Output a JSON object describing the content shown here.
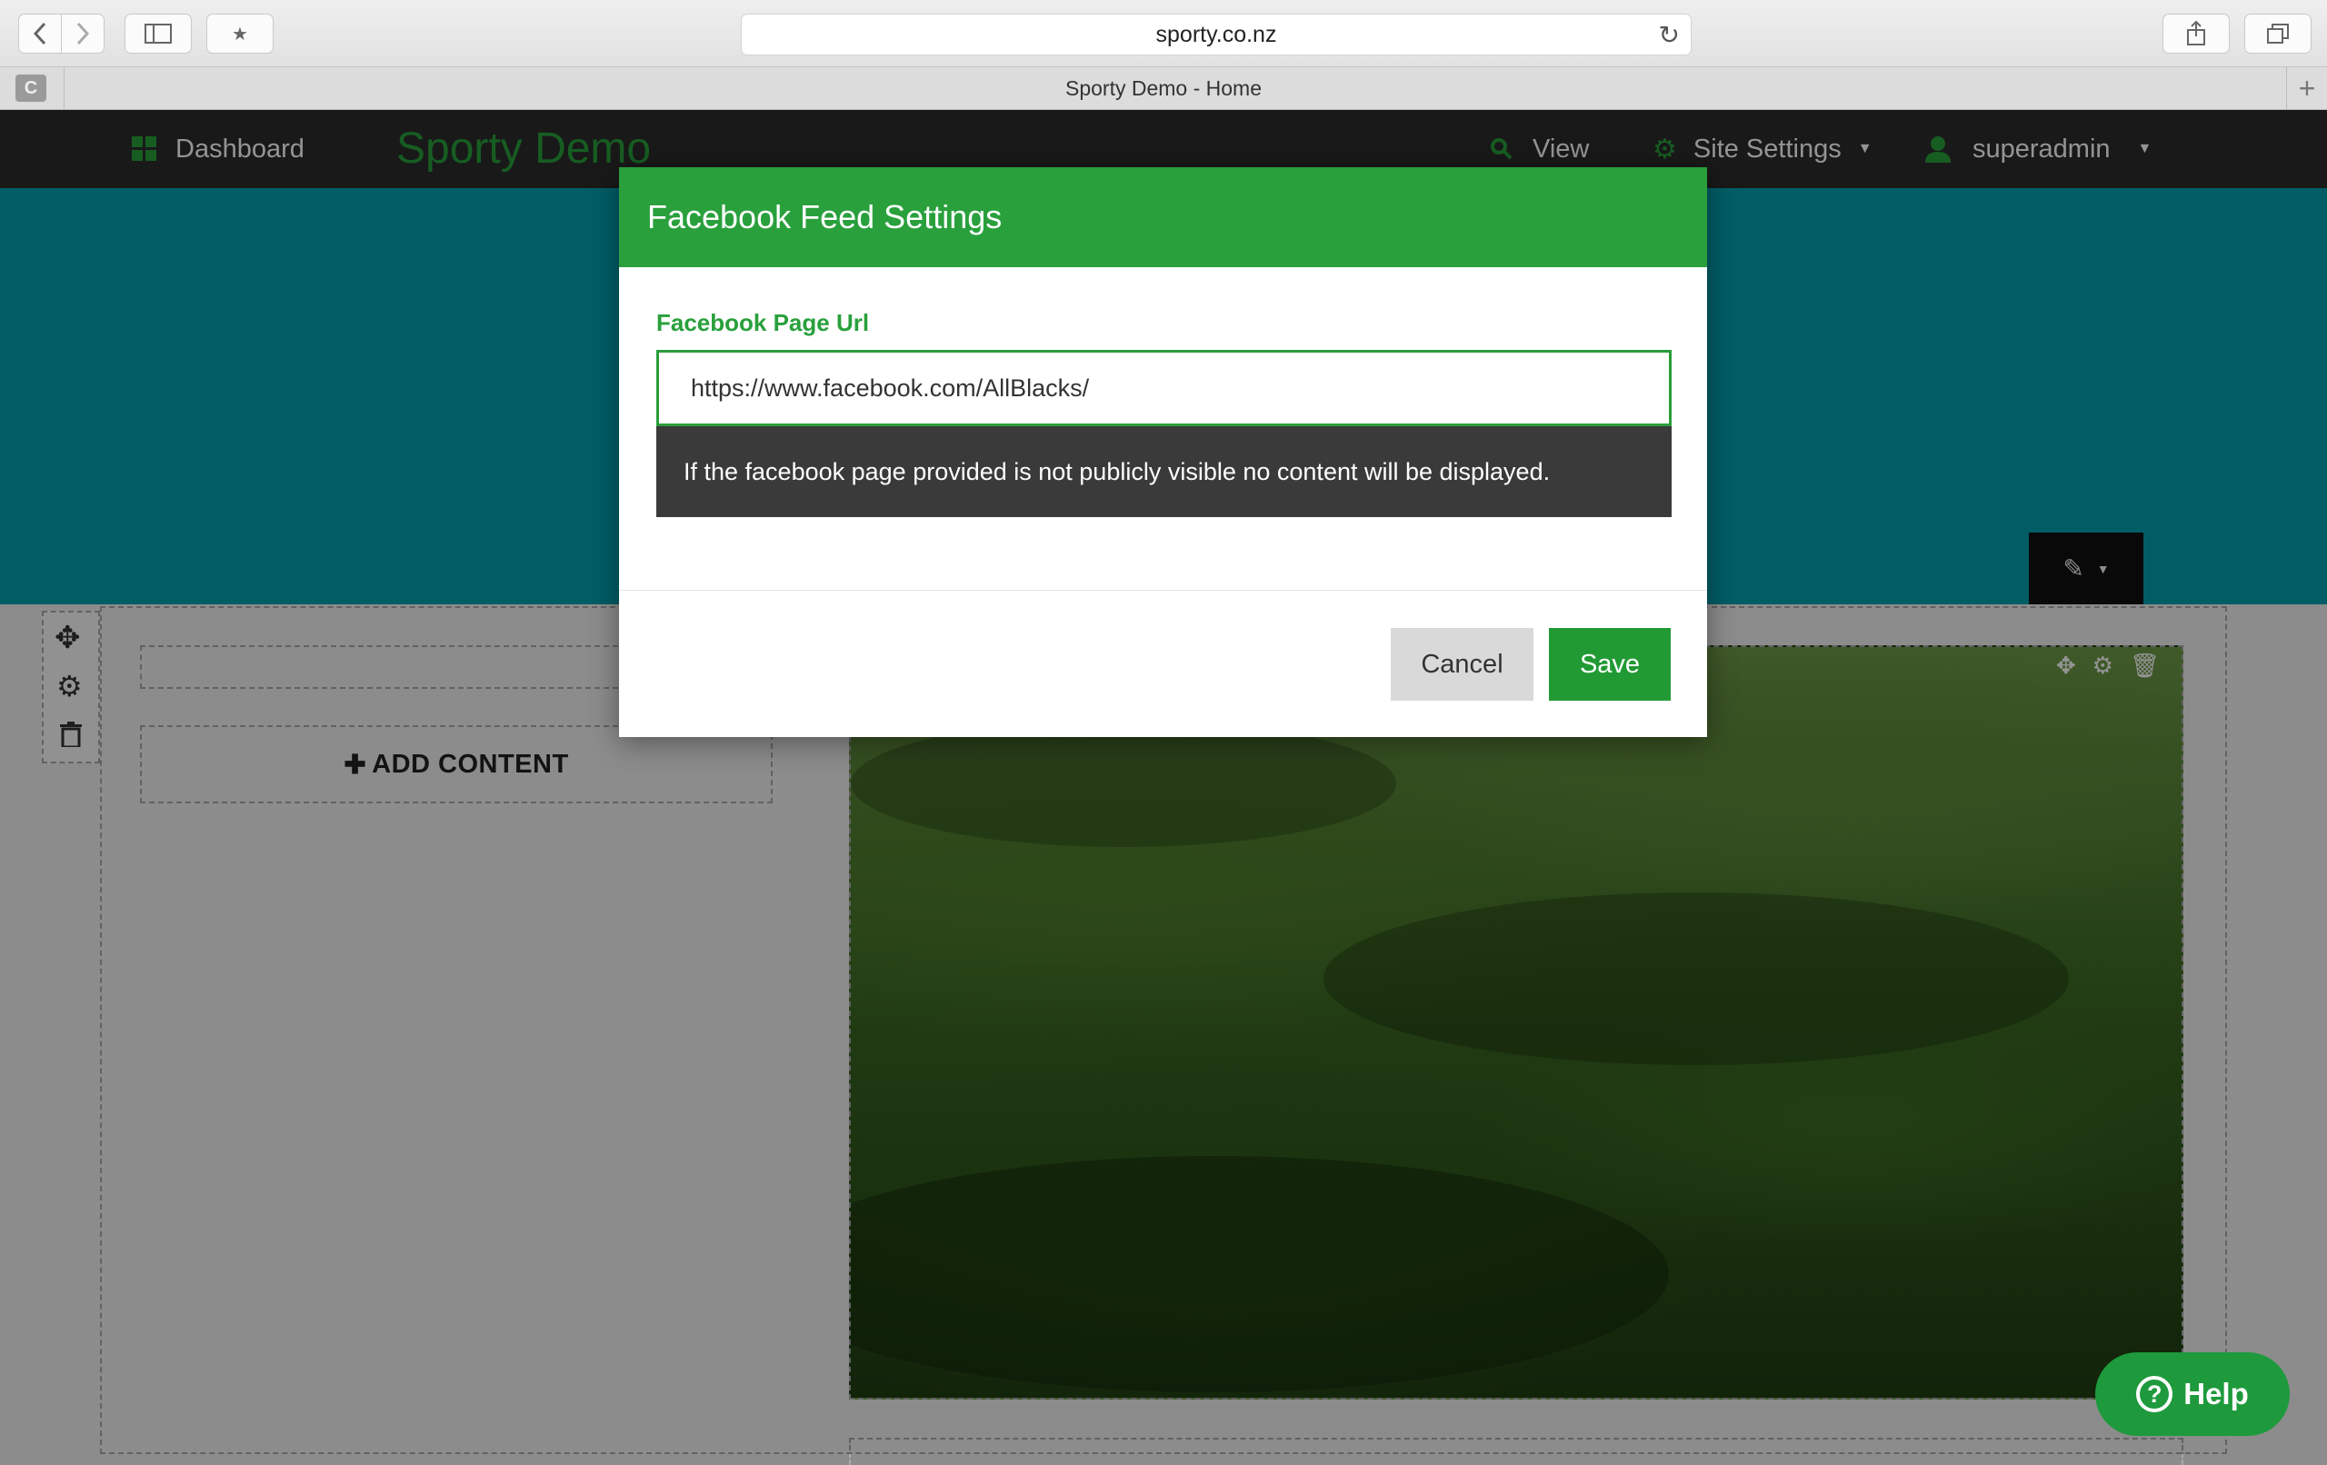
{
  "browser": {
    "url": "sporty.co.nz",
    "tab_title": "Sporty Demo - Home",
    "tab_favicon_letter": "C"
  },
  "topnav": {
    "dashboard_label": "Dashboard",
    "brand": "Sporty Demo",
    "view_label": "View",
    "site_settings_label": "Site Settings",
    "user_label": "superadmin"
  },
  "page": {
    "add_content_label": "ADD CONTENT"
  },
  "modal": {
    "title": "Facebook Feed Settings",
    "field_label": "Facebook Page Url",
    "field_value": "https://www.facebook.com/AllBlacks/",
    "notice": "If the facebook page provided is not publicly visible no content will be displayed.",
    "cancel_label": "Cancel",
    "save_label": "Save"
  },
  "help": {
    "label": "Help"
  },
  "colors": {
    "accent_green": "#29a03c",
    "hero_teal": "#00a0b0",
    "nav_dark": "#2b2b2b"
  }
}
